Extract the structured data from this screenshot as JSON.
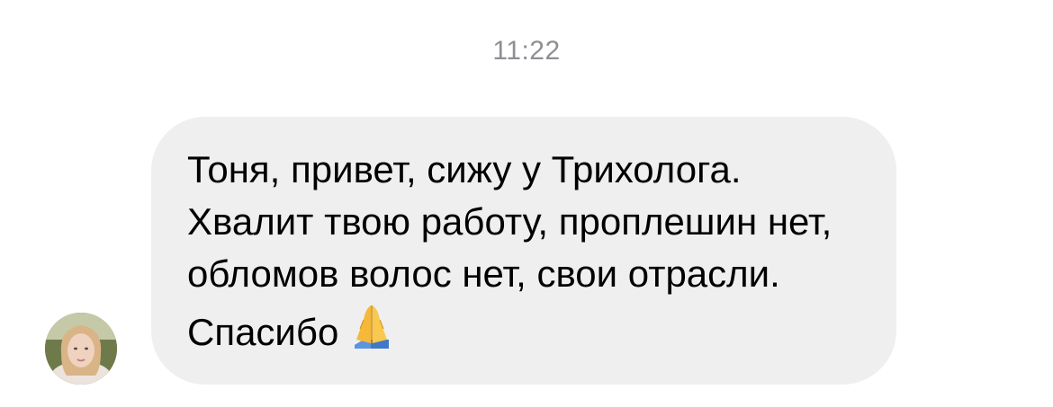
{
  "chat": {
    "timestamp": "11:22",
    "message": {
      "text": "Тоня, привет, сижу у Трихолога. Хвалит твою работу, проплешин нет, обломов волос нет, свои отрасли. Спасибо",
      "emoji_icon": "folded-hands-icon"
    },
    "sender_avatar": "avatar-photo"
  },
  "colors": {
    "bubble_background": "#efefef",
    "timestamp_text": "#8e8e93",
    "message_text": "#000000"
  }
}
